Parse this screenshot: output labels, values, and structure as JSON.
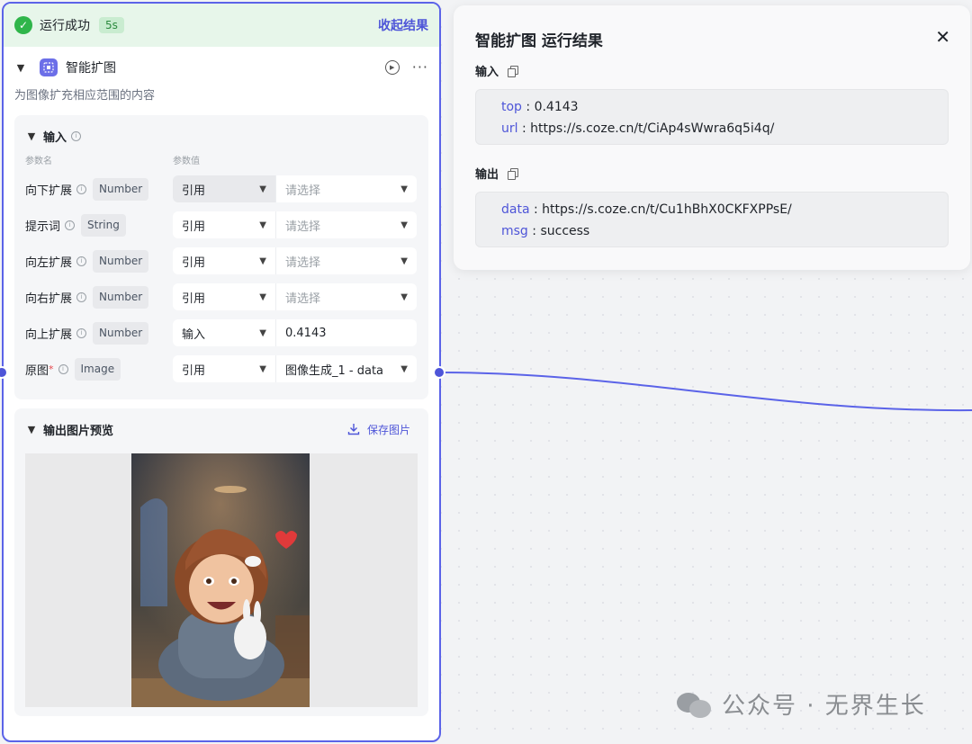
{
  "status": {
    "icon": "check-circle-icon",
    "text": "运行成功",
    "duration": "5s",
    "collapse_label": "收起结果"
  },
  "node": {
    "title": "智能扩图",
    "description": "为图像扩充相应范围的内容",
    "icon": "expand-image-icon"
  },
  "input_section": {
    "title": "输入",
    "col_name": "参数名",
    "col_value": "参数值",
    "params": [
      {
        "name": "向下扩展",
        "required": false,
        "type": "Number",
        "mode": "引用",
        "value": "",
        "placeholder": "请选择"
      },
      {
        "name": "提示词",
        "required": false,
        "type": "String",
        "mode": "引用",
        "value": "",
        "placeholder": "请选择"
      },
      {
        "name": "向左扩展",
        "required": false,
        "type": "Number",
        "mode": "引用",
        "value": "",
        "placeholder": "请选择"
      },
      {
        "name": "向右扩展",
        "required": false,
        "type": "Number",
        "mode": "引用",
        "value": "",
        "placeholder": "请选择"
      },
      {
        "name": "向上扩展",
        "required": false,
        "type": "Number",
        "mode": "输入",
        "value": "0.4143",
        "placeholder": ""
      },
      {
        "name": "原图",
        "required": true,
        "type": "Image",
        "mode": "引用",
        "value": "图像生成_1 - data",
        "placeholder": ""
      }
    ]
  },
  "preview": {
    "title": "输出图片预览",
    "save_label": "保存图片"
  },
  "result": {
    "title": "智能扩图 运行结果",
    "input_label": "输入",
    "inputs": [
      {
        "key": "top",
        "value": "0.4143"
      },
      {
        "key": "url",
        "value": "https://s.coze.cn/t/CiAp4sWwra6q5i4q/"
      }
    ],
    "output_label": "输出",
    "outputs": [
      {
        "key": "data",
        "value": "https://s.coze.cn/t/Cu1hBhX0CKFXPPsE/"
      },
      {
        "key": "msg",
        "value": "success"
      }
    ]
  },
  "watermark": "公众号 · 无界生长",
  "colors": {
    "accent": "#4e55d8",
    "success": "#2fb54a",
    "border": "#5b63e8"
  }
}
